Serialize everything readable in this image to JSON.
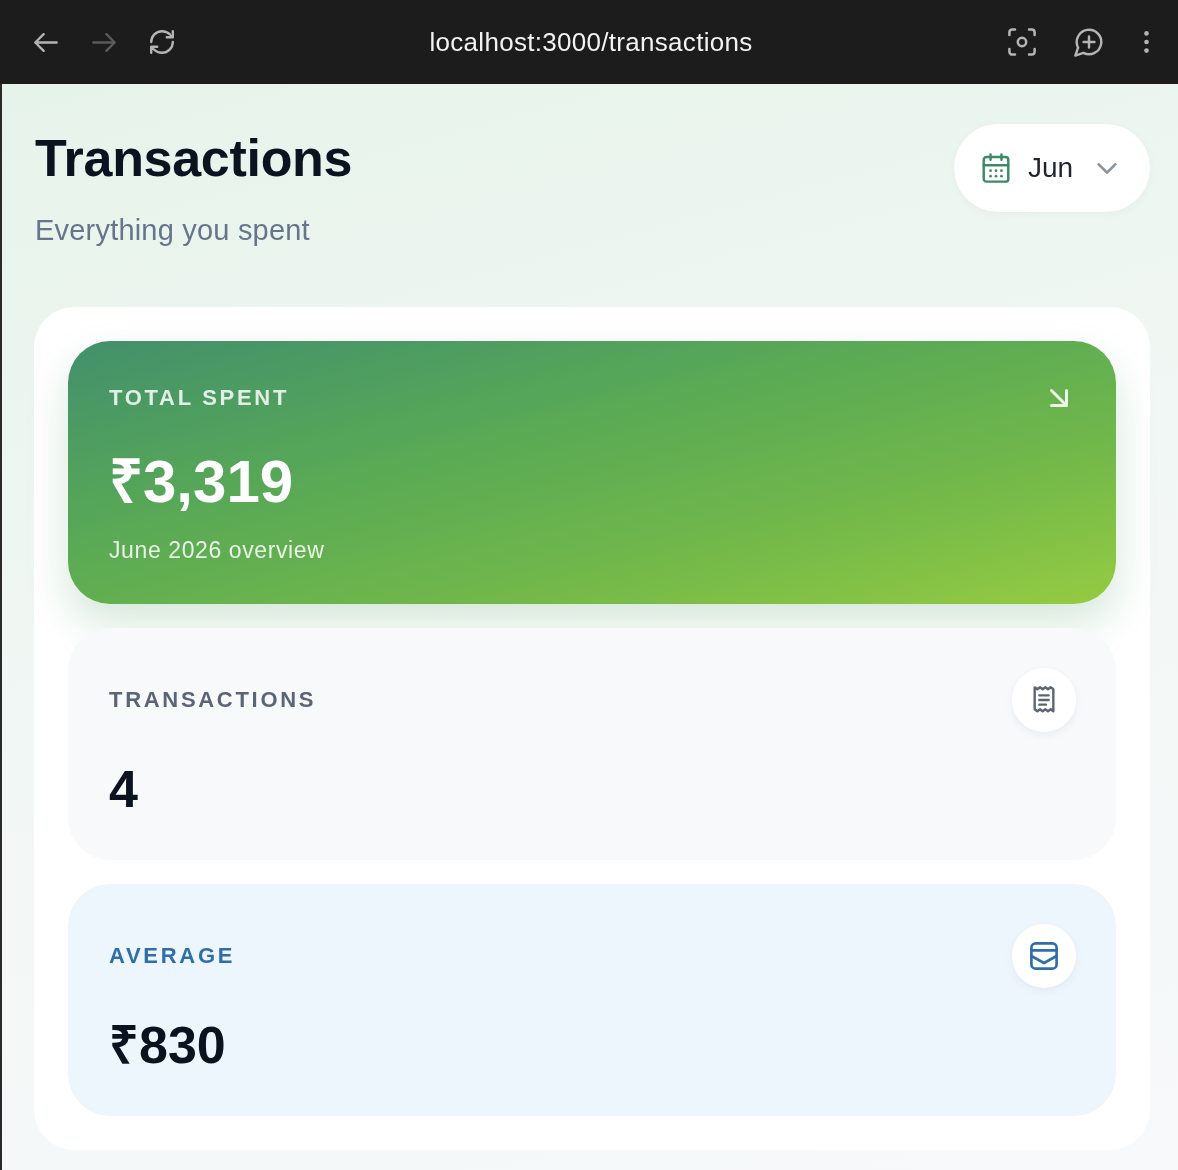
{
  "browser": {
    "nav_buttons": [
      {
        "kind": "back",
        "disabled": false
      },
      {
        "kind": "forward",
        "disabled": true
      },
      {
        "kind": "reload",
        "disabled": false
      }
    ],
    "url": "localhost:3000/transactions"
  },
  "header": {
    "title": "Transactions",
    "subtitle": "Everything you spent",
    "month_picker": {
      "value": "Jun"
    }
  },
  "stats": [
    {
      "kind": "hero",
      "label": "TOTAL SPENT",
      "value": "₹3,319",
      "caption": "June 2026 overview"
    },
    {
      "kind": "neutral",
      "label": "TRANSACTIONS",
      "value": "4"
    },
    {
      "kind": "info",
      "label": "AVERAGE",
      "value": "₹830"
    }
  ]
}
